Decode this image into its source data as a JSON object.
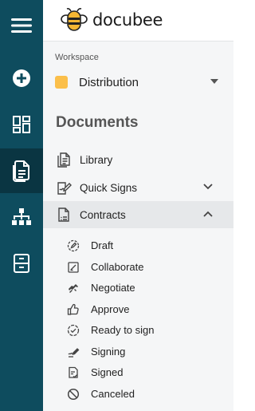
{
  "app": {
    "logo_text": "docubee"
  },
  "rail": {
    "items": [
      {
        "name": "menu",
        "icon": "hamburger-icon"
      },
      {
        "name": "create",
        "icon": "plus-circle-icon"
      },
      {
        "name": "dashboard",
        "icon": "dashboard-grid-icon"
      },
      {
        "name": "documents",
        "icon": "documents-icon",
        "active": true
      },
      {
        "name": "workflows",
        "icon": "org-chart-icon"
      },
      {
        "name": "archive",
        "icon": "file-cabinet-icon"
      }
    ]
  },
  "workspace": {
    "label": "Workspace",
    "selected": "Distribution",
    "swatch_color": "#fbbf4a"
  },
  "documents": {
    "title": "Documents",
    "items": [
      {
        "label": "Library",
        "icon": "library-doc-icon"
      },
      {
        "label": "Quick Signs",
        "icon": "quick-sign-icon",
        "expandable": true,
        "expanded": false
      },
      {
        "label": "Contracts",
        "icon": "contracts-doc-icon",
        "expandable": true,
        "expanded": true,
        "selected": true
      }
    ],
    "contract_statuses": [
      {
        "label": "Draft",
        "icon": "draft-icon"
      },
      {
        "label": "Collaborate",
        "icon": "collaborate-icon"
      },
      {
        "label": "Negotiate",
        "icon": "negotiate-icon"
      },
      {
        "label": "Approve",
        "icon": "thumbs-up-icon"
      },
      {
        "label": "Ready to sign",
        "icon": "check-circle-icon"
      },
      {
        "label": "Signing",
        "icon": "signing-pen-icon"
      },
      {
        "label": "Signed",
        "icon": "signed-doc-icon"
      },
      {
        "label": "Canceled",
        "icon": "canceled-icon"
      }
    ]
  },
  "colors": {
    "rail": "#0e4c5e",
    "rail_active": "#0a3542",
    "panel": "#f5f6f7",
    "selected_row": "#e6e8ea",
    "bee_yellow": "#f6b733"
  }
}
